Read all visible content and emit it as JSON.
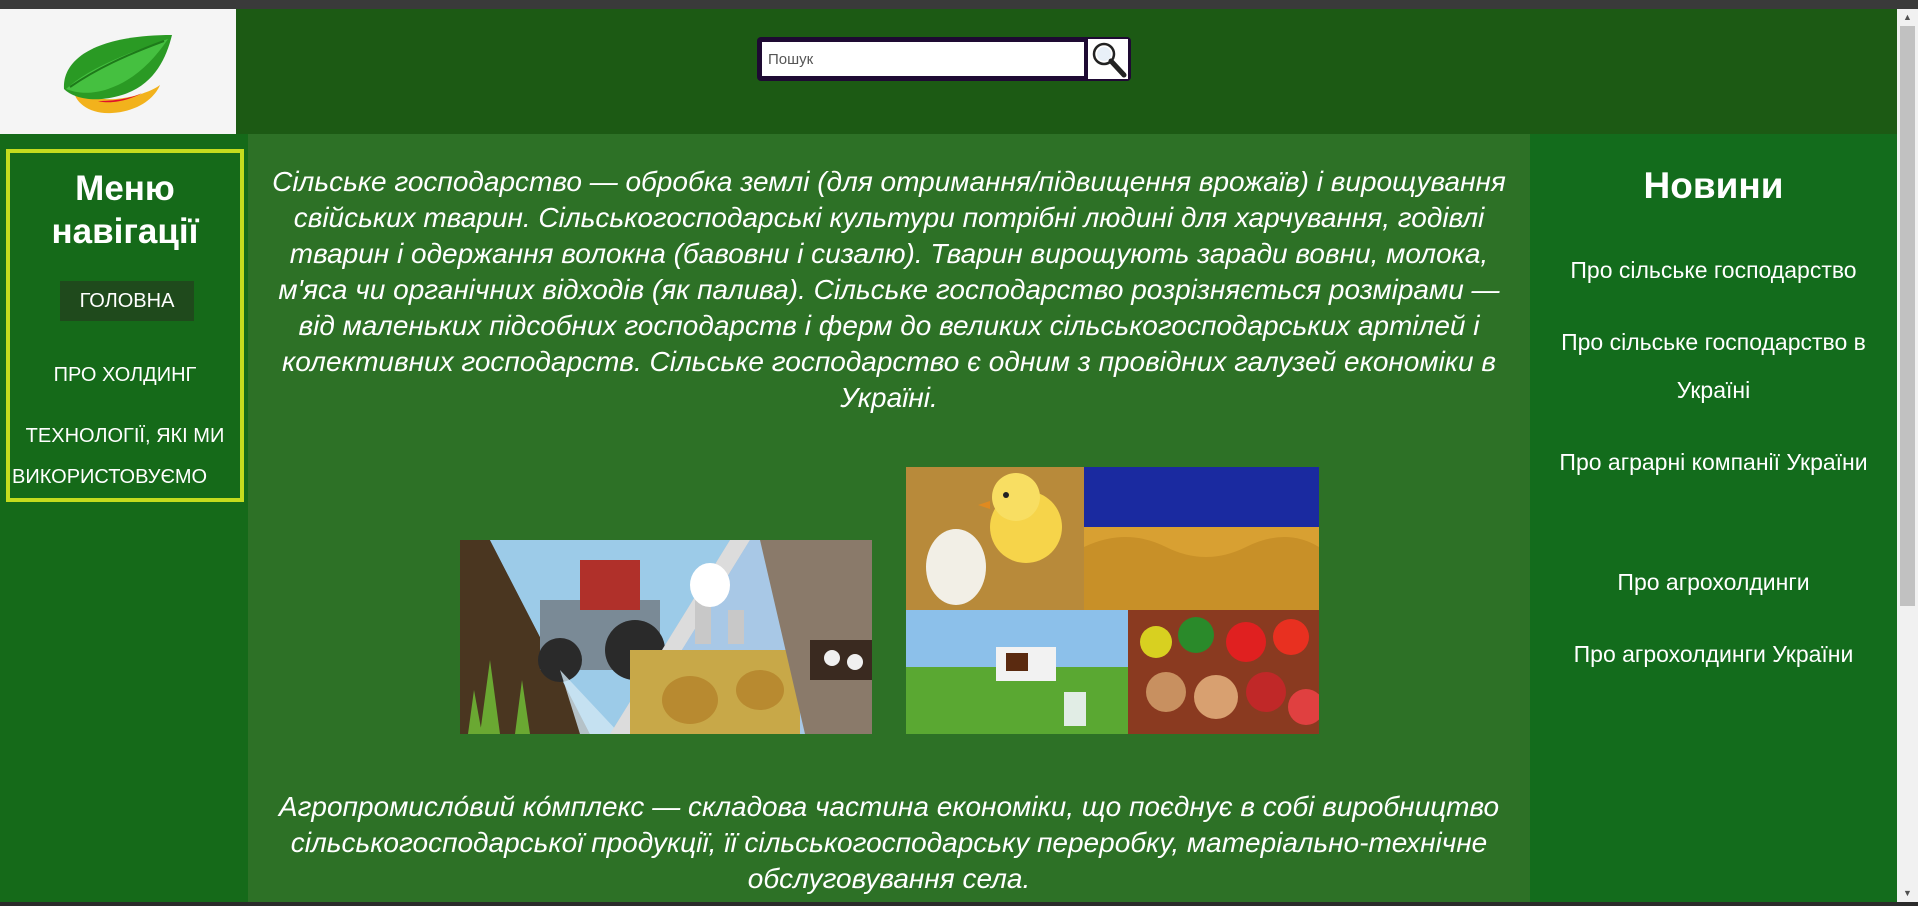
{
  "header": {
    "logo_icon": "leaf-logo-icon",
    "search": {
      "placeholder": "Пошук",
      "button_icon": "magnifier-icon"
    }
  },
  "nav": {
    "title": "Меню навігації",
    "items": [
      {
        "label": "ГОЛОВНА"
      },
      {
        "label": "ПРО ХОЛДИНГ"
      },
      {
        "label": "ТЕХНОЛОГІЇ, ЯКІ МИ ВИКОРИСТОВУЄМО"
      }
    ]
  },
  "main": {
    "intro": "Сільське господарство — обробка землі (для отримання/підвищення врожаїв) і вирощування свійських тварин. Сільськогосподарські культури потрібні людині для харчування, годівлі тварин і одержання волокна (бавовни і сизалю). Тварин вирощують заради вовни, молока, м'яса чи органічних відходів (як палива). Сільське господарство розрізняється розмірами — від маленьких підсобних господарств і ферм до великих сільськогосподарських артілей і колективних господарств. Сільське господарство є одним з провідних галузей економіки в Україні.",
    "images": [
      {
        "icon": "agriculture-collage-image"
      },
      {
        "icon": "farm-produce-collage-image"
      }
    ],
    "agro": "Агропромисло́вий ко́мплекс — складова частина економіки, що поєднує в собі виробництво сільськогосподарської продукції, її сільськогосподарську переробку, матеріально-технічне обслуговування села."
  },
  "news": {
    "title": "Новини",
    "items": [
      {
        "label": "Про сільське господарство"
      },
      {
        "label": "Про сільське господарство в Україні"
      },
      {
        "label": "Про аграрні компанії України"
      },
      {
        "label": "Про агрохолдинги"
      },
      {
        "label": "Про агрохолдинги України"
      }
    ]
  },
  "colors": {
    "header_bg": "#1c5a14",
    "sidebar_bg": "#156a19",
    "main_bg": "#2d7126",
    "nav_border": "#c4dc1e",
    "active_item_bg": "#1f4a1c"
  }
}
